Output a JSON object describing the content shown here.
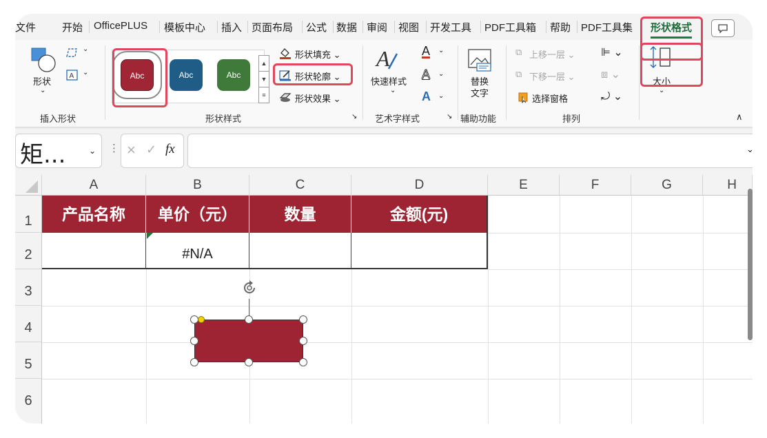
{
  "tabs": [
    "文件",
    "开始",
    "OfficePLUS",
    "模板中心",
    "插入",
    "页面布局",
    "公式",
    "数据",
    "审阅",
    "视图",
    "开发工具",
    "PDF工具箱",
    "帮助",
    "PDF工具集",
    "形状格式"
  ],
  "ribbon": {
    "insert_shapes": {
      "shape_label": "形状",
      "group_label": "插入形状"
    },
    "shape_styles": {
      "styles": [
        {
          "text": "Abc",
          "color": "#a02535"
        },
        {
          "text": "Abc",
          "color": "#1f5c86"
        },
        {
          "text": "Abc",
          "color": "#3f7a3a"
        }
      ],
      "fill_label": "形状填充",
      "outline_label": "形状轮廓",
      "effect_label": "形状效果",
      "group_label": "形状样式"
    },
    "wordart": {
      "quick_styles_label": "快速样式",
      "group_label": "艺术字样式"
    },
    "accessibility": {
      "alt_text_label_1": "替换",
      "alt_text_label_2": "文字",
      "group_label": "辅助功能"
    },
    "arrange": {
      "bring_forward": "上移一层",
      "send_backward": "下移一层",
      "selection_pane": "选择窗格",
      "group_label": "排列"
    },
    "size": {
      "label": "大小"
    }
  },
  "formula_bar": {
    "name_box": "矩...",
    "fx": "fx",
    "formula": ""
  },
  "sheet": {
    "columns": [
      "A",
      "B",
      "C",
      "D",
      "E",
      "F",
      "G",
      "H"
    ],
    "rows": [
      "1",
      "2",
      "3",
      "4",
      "5",
      "6"
    ],
    "headers": [
      "产品名称",
      "单价（元）",
      "数量",
      "金额(元)"
    ],
    "row2": [
      "",
      "#N/A",
      "",
      ""
    ],
    "shape_fill": "#9e2433",
    "accent": "#e0475c"
  }
}
